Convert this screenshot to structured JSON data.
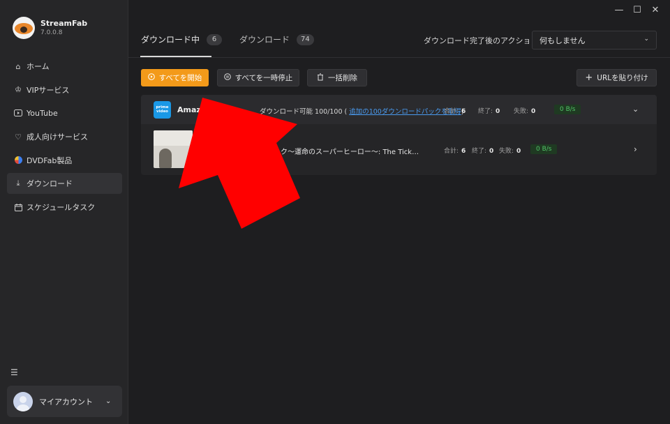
{
  "app": {
    "name": "StreamFab",
    "version": "7.0.0.8"
  },
  "window_controls": {
    "minimize": "—",
    "maximize": "☐",
    "close": "✕"
  },
  "sidebar": {
    "items": [
      {
        "label": "ホーム",
        "icon": "home-icon"
      },
      {
        "label": "VIPサービス",
        "icon": "crown-icon"
      },
      {
        "label": "YouTube",
        "icon": "youtube-icon"
      },
      {
        "label": "成人向けサービス",
        "icon": "heart-icon"
      },
      {
        "label": "DVDFab製品",
        "icon": "dvdfab-icon"
      },
      {
        "label": "ダウンロード",
        "icon": "download-icon"
      },
      {
        "label": "スケジュールタスク",
        "icon": "calendar-icon"
      }
    ],
    "active": "ダウンロード",
    "menu_icon": "menu-icon",
    "account": {
      "label": "マイアカウント"
    }
  },
  "tabs": [
    {
      "label": "ダウンロード中",
      "count": "6"
    },
    {
      "label": "ダウンロード",
      "count": "74"
    }
  ],
  "post_action": {
    "label": "ダウンロード完了後のアクション：",
    "value": "何もしません"
  },
  "toolbar": {
    "start_all": "すべてを開始",
    "pause_all": "すべてを一時停止",
    "delete_all": "一括削除",
    "paste_url": "URLを貼り付け"
  },
  "group": {
    "service": "Amazo",
    "icon_text": "prime video",
    "quota_prefix": "ダウンロード可能 100/100 (",
    "quota_link": "追加の100ダウンロードパックを取得",
    "quota_suffix": ")",
    "stats": {
      "total_label": "合計:",
      "total": "6",
      "done_label": "終了:",
      "done": "0",
      "fail_label": "失敗:",
      "fail": "0",
      "speed": "0 B/s"
    }
  },
  "item": {
    "title": "ック〜運命のスーパーヒーロー〜: The Tick…",
    "stats": {
      "total_label": "合計:",
      "total": "6",
      "done_label": "終了:",
      "done": "0",
      "fail_label": "失敗:",
      "fail": "0",
      "speed": "0 B/s"
    }
  },
  "colors": {
    "accent": "#f39a1a",
    "annotation": "#ff0000",
    "link": "#4a9bf0",
    "speed_text": "#52c468"
  }
}
